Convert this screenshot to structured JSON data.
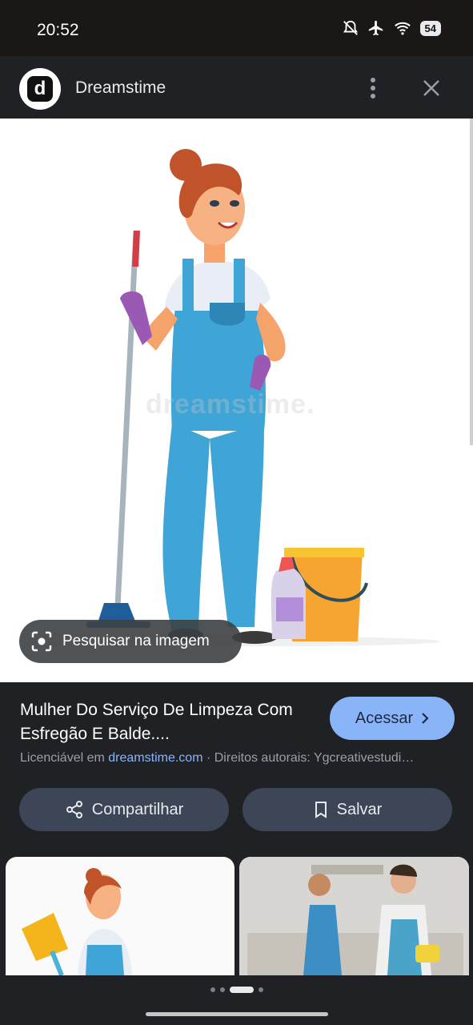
{
  "status": {
    "time": "20:52",
    "battery": "54"
  },
  "header": {
    "site_name": "Dreamstime",
    "logo_letter": "d"
  },
  "image": {
    "watermark": "dreamstime.",
    "lens_label": "Pesquisar na imagem"
  },
  "result": {
    "title": "Mulher Do Serviço De Limpeza Com Esfregão E Balde....",
    "access_label": "Acessar",
    "meta_prefix": "Licenciável em ",
    "meta_domain": "dreamstime.com",
    "meta_suffix": " · Direitos autorais: Ygcreativestudi…"
  },
  "actions": {
    "share_label": "Compartilhar",
    "save_label": "Salvar"
  },
  "colors": {
    "accent": "#8ab4f8",
    "surface": "#202124",
    "button": "#3c4656"
  }
}
